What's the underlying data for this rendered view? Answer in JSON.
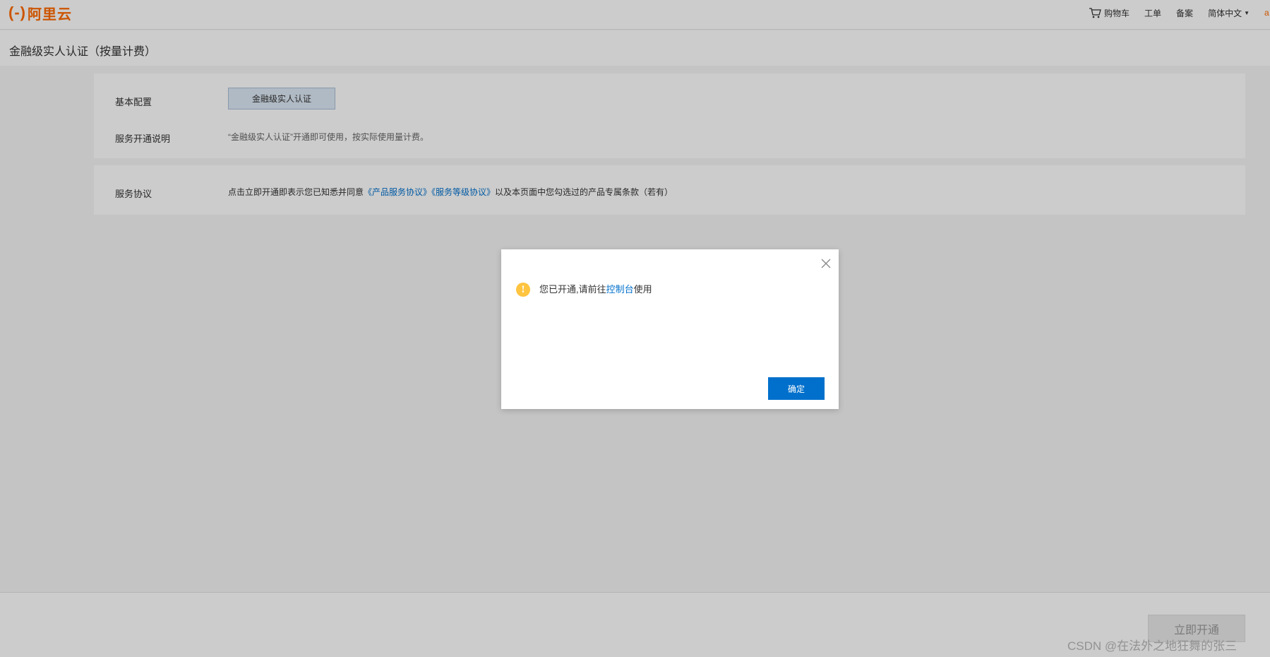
{
  "header": {
    "logo_text": "阿里云",
    "logo_bracket": "(-)",
    "nav": {
      "cart": "购物车",
      "ticket": "工单",
      "filing": "备案",
      "language": "简体中文",
      "edge_fragment": "a"
    }
  },
  "page": {
    "title": "金融级实人认证（按量计费）"
  },
  "config": {
    "basic_label": "基本配置",
    "basic_option": "金融级实人认证",
    "service_label": "服务开通说明",
    "service_desc": "“金融级实人认证”开通即可使用，按实际使用量计费。"
  },
  "agreement": {
    "label": "服务协议",
    "prefix": "点击立即开通即表示您已知悉并同意",
    "link1": "《产品服务协议》",
    "link2": "《服务等级协议》",
    "suffix": "以及本页面中您勾选过的产品专属条款（若有）"
  },
  "footer": {
    "open_button": "立即开通",
    "watermark": "CSDN @在法外之地狂舞的张三"
  },
  "dialog": {
    "msg_prefix": "您已开通,请前往",
    "msg_link": "控制台",
    "msg_suffix": "使用",
    "confirm": "确定",
    "warn_glyph": "!"
  },
  "colors": {
    "brand": "#ff6a00",
    "primary": "#0070cc",
    "warning": "#ffc440"
  }
}
